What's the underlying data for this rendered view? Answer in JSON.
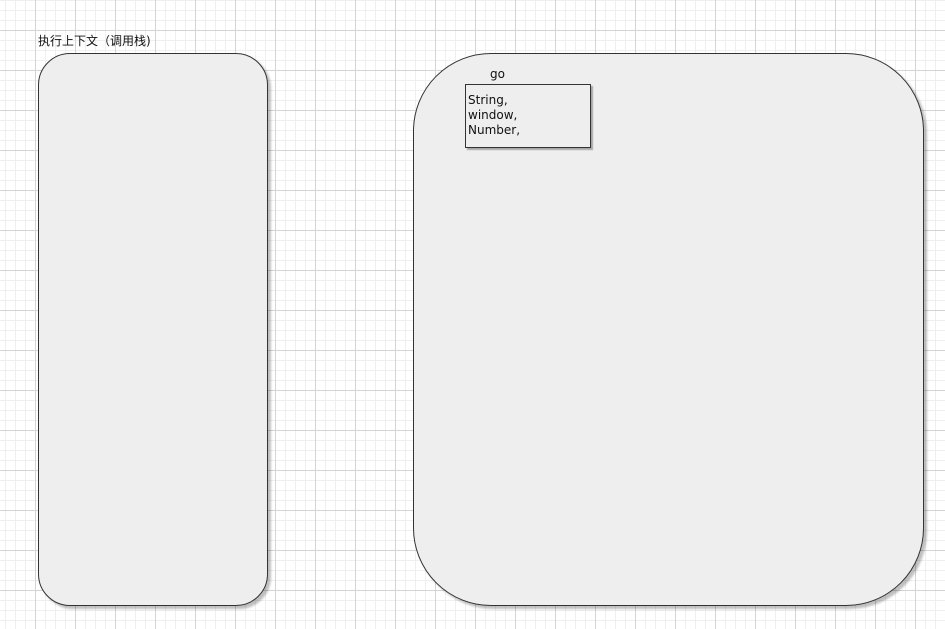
{
  "diagram": {
    "call_stack": {
      "title": "执行上下文（调用栈)"
    },
    "heap": {
      "object_label": "go",
      "object_entries": [
        "String,",
        "window,",
        "Number,"
      ]
    }
  },
  "colors": {
    "panel_fill": "#eeeeee",
    "panel_border": "#333333",
    "grid_major": "#d4d4d4",
    "grid_minor": "#efefef"
  }
}
